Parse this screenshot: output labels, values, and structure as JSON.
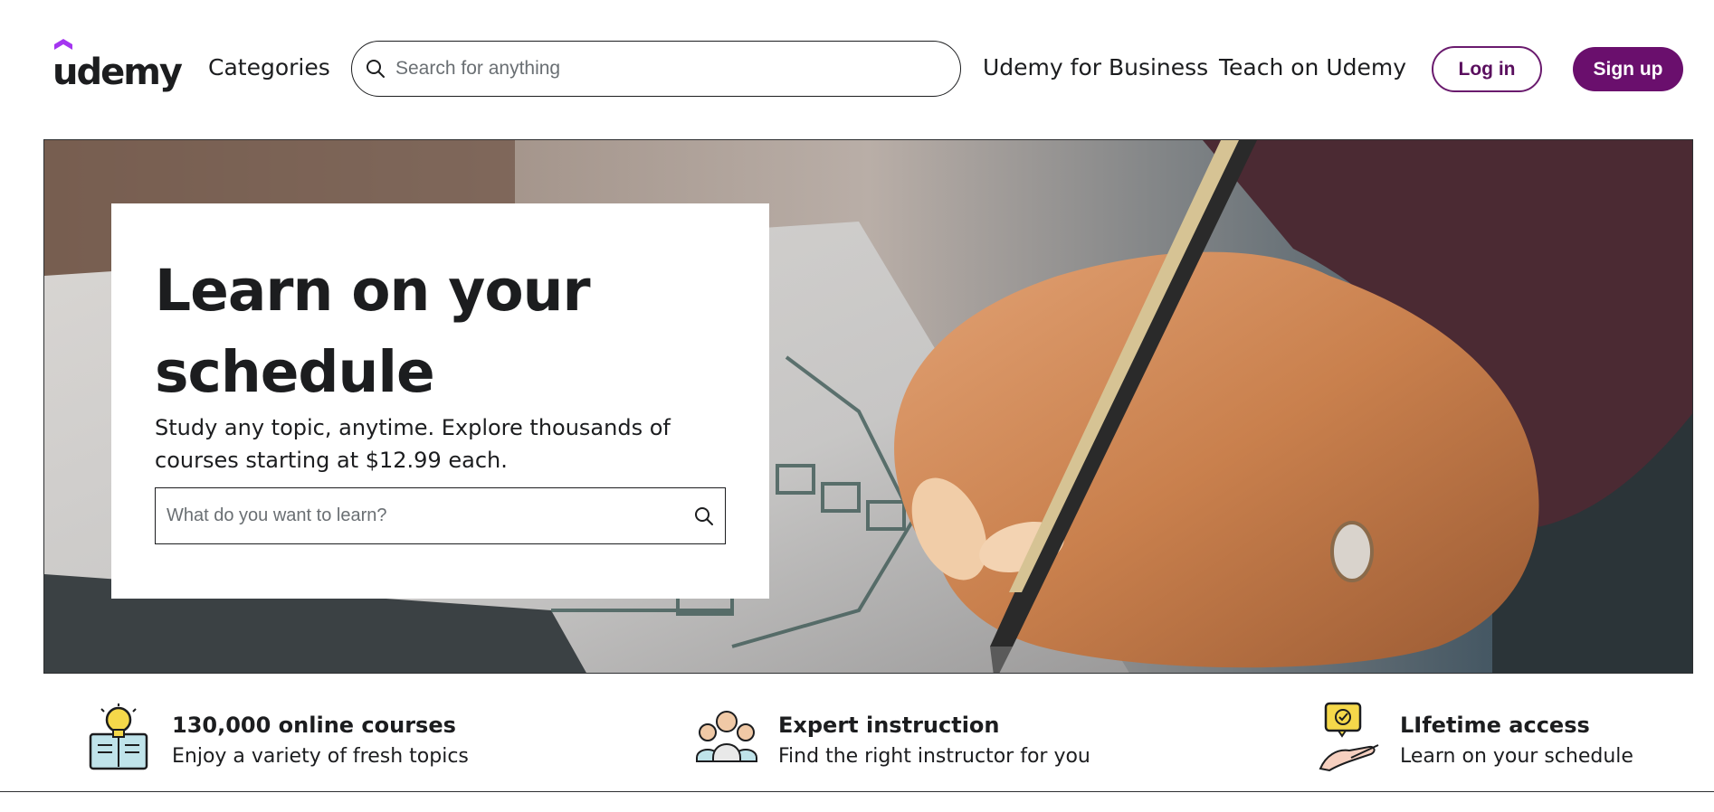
{
  "header": {
    "logo_text": "udemy",
    "categories_label": "Categories",
    "search_placeholder": "Search for anything",
    "business_link": "Udemy for Business",
    "teach_link": "Teach on Udemy",
    "login_label": "Log in",
    "signup_label": "Sign up"
  },
  "hero": {
    "title": "Learn on your schedule",
    "subtitle": "Study any topic, anytime. Explore thousands of courses starting at $12.99 each.",
    "search_placeholder": "What do you want to learn?"
  },
  "features": [
    {
      "icon": "book-lightbulb-icon",
      "title": "130,000 online courses",
      "description": "Enjoy a variety of fresh topics"
    },
    {
      "icon": "instructors-icon",
      "title": "Expert instruction",
      "description": "Find the right instructor for you"
    },
    {
      "icon": "lifetime-access-hand-icon",
      "title": "LIfetime access",
      "description": "Learn on your schedule"
    }
  ],
  "colors": {
    "brand_purple": "#6a0f6d",
    "text": "#1c1d1f",
    "placeholder": "#6a6f73",
    "icon_yellow": "#f5d84a",
    "icon_teal": "#bfe3ea"
  }
}
